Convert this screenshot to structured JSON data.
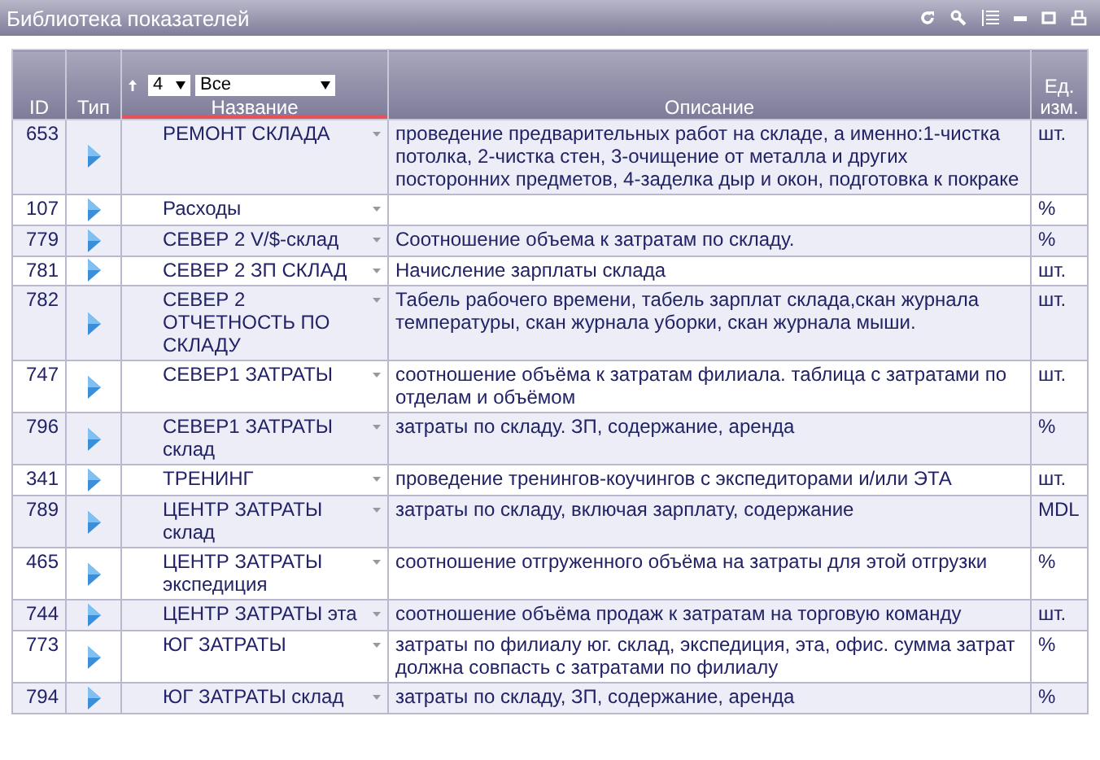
{
  "window": {
    "title": "Библиотека показателей"
  },
  "filter": {
    "count_select": "4",
    "group_select": "Все"
  },
  "columns": [
    {
      "label": "ID",
      "sorted": false
    },
    {
      "label": "Тип",
      "sorted": false
    },
    {
      "label": "Название",
      "sorted": true
    },
    {
      "label": "Описание",
      "sorted": false
    },
    {
      "label": "Ед. изм.",
      "sorted": false
    }
  ],
  "rows": [
    {
      "id": "653",
      "name": "РЕМОНТ СКЛАДА",
      "description": "проведение предварительных работ на складе, а именно:1-чистка потолка, 2-чистка стен, 3-очищение от металла и других посторонних предметов, 4-заделка дыр и окон, подготовка к покраке",
      "unit": "шт."
    },
    {
      "id": "107",
      "name": "Расходы",
      "description": "",
      "unit": "%"
    },
    {
      "id": "779",
      "name": "СЕВЕР 2 V/$-склад",
      "description": "Соотношение объема к затратам по складу.",
      "unit": "%"
    },
    {
      "id": "781",
      "name": "СЕВЕР 2 ЗП СКЛАД",
      "description": "Начисление зарплаты склада",
      "unit": "шт."
    },
    {
      "id": "782",
      "name": "СЕВЕР 2 ОТЧЕТНОСТЬ ПО СКЛАДУ",
      "description": "Табель рабочего времени, табель зарплат склада,скан журнала температуры, скан журнала уборки, скан журнала мыши.",
      "unit": "шт."
    },
    {
      "id": "747",
      "name": "СЕВЕР1 ЗАТРАТЫ",
      "description": "соотношение объёма к затратам филиала. таблица с затратами по отделам и объёмом",
      "unit": "шт."
    },
    {
      "id": "796",
      "name": "СЕВЕР1 ЗАТРАТЫ склад",
      "description": "затраты по складу. ЗП, содержание, аренда",
      "unit": "%"
    },
    {
      "id": "341",
      "name": "ТРЕНИНГ",
      "description": "проведение тренингов-коучингов с экспедиторами и/или ЭТА",
      "unit": "шт."
    },
    {
      "id": "789",
      "name": "ЦЕНТР ЗАТРАТЫ склад",
      "description": "затраты по складу, включая зарплату, содержание",
      "unit": "MDL"
    },
    {
      "id": "465",
      "name": "ЦЕНТР ЗАТРАТЫ экспедиция",
      "description": "соотношение отгруженного объёма на затраты для этой отгрузки",
      "unit": "%"
    },
    {
      "id": "744",
      "name": "ЦЕНТР ЗАТРАТЫ эта",
      "description": "соотношение объёма продаж к затратам на торговую команду",
      "unit": "шт."
    },
    {
      "id": "773",
      "name": "ЮГ ЗАТРАТЫ",
      "description": "затраты по филиалу юг. склад, экспедиция, эта, офис. сумма затрат должна совпасть с затратами по филиалу",
      "unit": "%"
    },
    {
      "id": "794",
      "name": "ЮГ ЗАТРАТЫ склад",
      "description": "затраты по складу, ЗП, содержание, аренда",
      "unit": "%"
    }
  ]
}
